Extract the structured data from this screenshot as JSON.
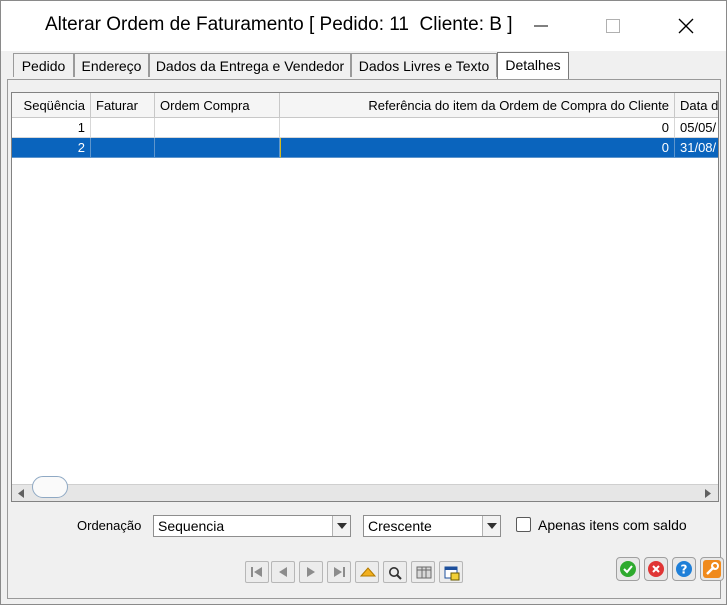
{
  "window": {
    "title": "Alterar Ordem de Faturamento [ Pedido: 11  Cliente: B ]",
    "controls": [
      "minimize-icon",
      "maximize-icon",
      "close-icon"
    ]
  },
  "tabs": [
    {
      "label": "Pedido",
      "active": false
    },
    {
      "label": "Endereço",
      "active": false
    },
    {
      "label": "Dados da Entrega e Vendedor",
      "active": false
    },
    {
      "label": "Dados Livres e Texto",
      "active": false
    },
    {
      "label": "Detalhes",
      "active": true
    }
  ],
  "grid": {
    "columns": [
      "Seqüência",
      "Faturar",
      "Ordem Compra",
      "Referência do item da Ordem de Compra do Cliente",
      "Data d"
    ],
    "rows": [
      {
        "seq": "1",
        "faturar": "",
        "ordem": "",
        "referencia": "0",
        "data": "05/05/",
        "selected": false
      },
      {
        "seq": "2",
        "faturar": "",
        "ordem": "",
        "referencia": "0",
        "data": "31/08/",
        "selected": true
      }
    ]
  },
  "footer": {
    "ordenacao_label": "Ordenação",
    "sort_field": "Sequencia",
    "sort_direction": "Crescente",
    "only_balance_label": "Apenas itens com saldo",
    "only_balance_checked": false
  },
  "toolbar": {
    "nav_icons": [
      "first-record-icon",
      "previous-record-icon",
      "next-record-icon",
      "last-record-icon",
      "up-arrow-icon",
      "search-icon",
      "grid-icon",
      "calculator-icon"
    ],
    "action_icons": [
      "confirm-icon",
      "cancel-icon",
      "help-icon",
      "tools-icon"
    ]
  },
  "colors": {
    "selection": "#0a64bd",
    "confirm": "#2eaa2e",
    "cancel": "#e03535",
    "help": "#1e7fd8",
    "tools": "#f08a1c"
  }
}
